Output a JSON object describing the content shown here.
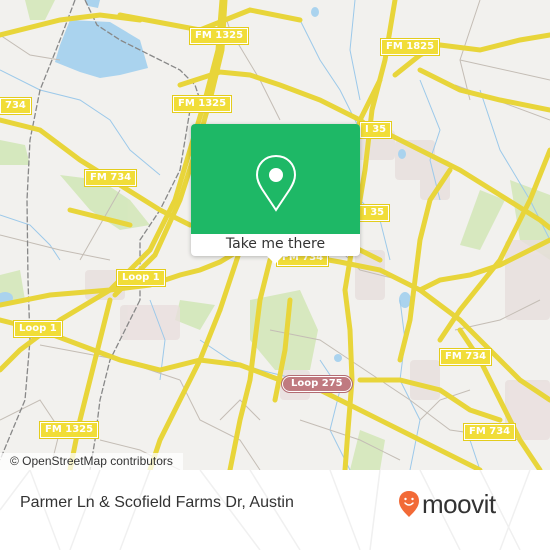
{
  "map": {
    "shields": [
      {
        "id": "fm1325-top",
        "label": "FM 1325"
      },
      {
        "id": "fm1825",
        "label": "FM 1825"
      },
      {
        "id": "fm734-left",
        "label": "734"
      },
      {
        "id": "fm1325-mid",
        "label": "FM 1325"
      },
      {
        "id": "i35-top",
        "label": "I 35"
      },
      {
        "id": "fm734-nw",
        "label": "FM 734"
      },
      {
        "id": "i35-mid",
        "label": "I 35"
      },
      {
        "id": "loop1-center",
        "label": "Loop 1"
      },
      {
        "id": "fm734-center",
        "label": "FM 734"
      },
      {
        "id": "loop1-left",
        "label": "Loop 1"
      },
      {
        "id": "fm734-east",
        "label": "FM 734"
      },
      {
        "id": "loop275",
        "label": "Loop 275"
      },
      {
        "id": "fm1325-bottom",
        "label": "FM 1325"
      },
      {
        "id": "fm734-se",
        "label": "FM 734"
      }
    ],
    "attribution": "© OpenStreetMap contributors"
  },
  "popup": {
    "icon": "map-pin-icon",
    "button_label": "Take me there",
    "accent_color": "#1eb866"
  },
  "footer": {
    "place_name": "Parmer Ln & Scofield Farms Dr, Austin",
    "brand": "moovit",
    "brand_color": "#f26a37"
  }
}
